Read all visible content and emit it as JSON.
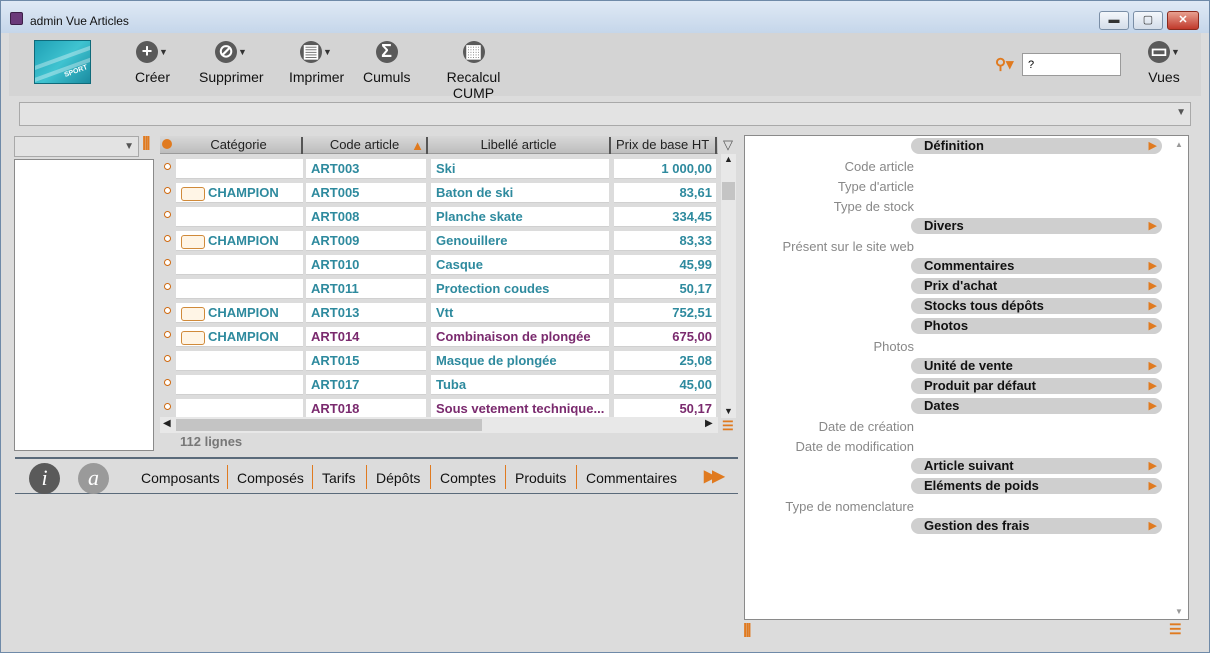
{
  "window": {
    "title": "admin Vue Articles"
  },
  "toolbar": {
    "create": "Créer",
    "delete": "Supprimer",
    "print": "Imprimer",
    "totals": "Cumuls",
    "recalc": "Recalcul CUMP",
    "views": "Vues",
    "search_value": "?"
  },
  "grid": {
    "headers": [
      "Catégorie",
      "Code article",
      "Libellé article",
      "Prix de base HT"
    ],
    "rows": [
      {
        "category": "",
        "code": "ART003",
        "label": "Ski",
        "price": "1 000,00",
        "color": "teal"
      },
      {
        "category": "CHAMPION",
        "code": "ART005",
        "label": "Baton de ski",
        "price": "83,61",
        "color": "teal"
      },
      {
        "category": "",
        "code": "ART008",
        "label": "Planche skate",
        "price": "334,45",
        "color": "teal"
      },
      {
        "category": "CHAMPION",
        "code": "ART009",
        "label": "Genouillere",
        "price": "83,33",
        "color": "teal"
      },
      {
        "category": "",
        "code": "ART010",
        "label": "Casque",
        "price": "45,99",
        "color": "teal"
      },
      {
        "category": "",
        "code": "ART011",
        "label": "Protection coudes",
        "price": "50,17",
        "color": "teal"
      },
      {
        "category": "CHAMPION",
        "code": "ART013",
        "label": "Vtt",
        "price": "752,51",
        "color": "teal"
      },
      {
        "category": "CHAMPION",
        "code": "ART014",
        "label": "Combinaison de plongée",
        "price": "675,00",
        "color": "purple"
      },
      {
        "category": "",
        "code": "ART015",
        "label": "Masque de plongée",
        "price": "25,08",
        "color": "teal"
      },
      {
        "category": "",
        "code": "ART017",
        "label": "Tuba",
        "price": "45,00",
        "color": "teal"
      },
      {
        "category": "",
        "code": "ART018",
        "label": "Sous vetement technique...",
        "price": "50,17",
        "color": "purple"
      }
    ],
    "count": "112 lignes"
  },
  "tabs": [
    "Composants",
    "Composés",
    "Tarifs",
    "Dépôts",
    "Comptes",
    "Produits",
    "Commentaires"
  ],
  "detail": {
    "sections": [
      {
        "label": "Définition"
      },
      {
        "label": "Divers"
      },
      {
        "label": "Commentaires"
      },
      {
        "label": "Prix d'achat"
      },
      {
        "label": "Stocks tous dépôts"
      },
      {
        "label": "Photos"
      },
      {
        "label": "Unité de vente"
      },
      {
        "label": "Produit par défaut"
      },
      {
        "label": "Dates"
      },
      {
        "label": "Article suivant"
      },
      {
        "label": "Eléments de poids"
      },
      {
        "label": "Gestion des frais"
      }
    ],
    "fields": [
      "Code article",
      "Type d'article",
      "Type de stock",
      "Présent sur le site web",
      "Photos",
      "Date de création",
      "Date de modification",
      "Type de nomenclature"
    ]
  },
  "colors": {
    "accent": "#e07a1f",
    "teal": "#2e8a9e",
    "purple": "#7a2a6e"
  }
}
